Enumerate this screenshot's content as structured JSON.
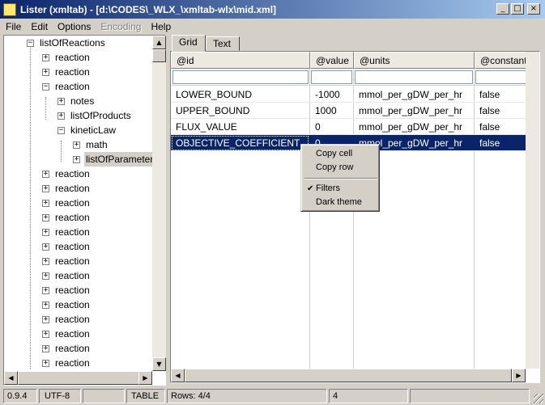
{
  "window": {
    "title": "Lister (xmltab) - [d:\\CODES\\_WLX_\\xmltab-wlx\\mid.xml]",
    "minimize": "_",
    "maximize": "□",
    "close": "×"
  },
  "menu": [
    "File",
    "Edit",
    "Options",
    "Encoding",
    "Help"
  ],
  "tree": {
    "nodes": [
      {
        "label": "listOfReactions",
        "expander": "−"
      },
      {
        "label": "reaction",
        "expander": "+"
      },
      {
        "label": "reaction",
        "expander": "+"
      },
      {
        "label": "reaction",
        "expander": "−"
      },
      {
        "label": "notes",
        "expander": "+"
      },
      {
        "label": "listOfProducts",
        "expander": "+"
      },
      {
        "label": "kineticLaw",
        "expander": "−"
      },
      {
        "label": "math",
        "expander": "+"
      },
      {
        "label": "listOfParameters",
        "expander": "+"
      },
      {
        "label": "reaction",
        "expander": "+"
      },
      {
        "label": "reaction",
        "expander": "+"
      },
      {
        "label": "reaction",
        "expander": "+"
      },
      {
        "label": "reaction",
        "expander": "+"
      },
      {
        "label": "reaction",
        "expander": "+"
      },
      {
        "label": "reaction",
        "expander": "+"
      },
      {
        "label": "reaction",
        "expander": "+"
      },
      {
        "label": "reaction",
        "expander": "+"
      },
      {
        "label": "reaction",
        "expander": "+"
      },
      {
        "label": "reaction",
        "expander": "+"
      },
      {
        "label": "reaction",
        "expander": "+"
      },
      {
        "label": "reaction",
        "expander": "+"
      },
      {
        "label": "reaction",
        "expander": "+"
      },
      {
        "label": "reaction",
        "expander": "+"
      }
    ],
    "selected_index": 8
  },
  "tabs": [
    "Grid",
    "Text"
  ],
  "active_tab": "Grid",
  "grid": {
    "columns": [
      "@id",
      "@value",
      "@units",
      "@constant"
    ],
    "rows": [
      [
        "LOWER_BOUND",
        "-1000",
        "mmol_per_gDW_per_hr",
        "false"
      ],
      [
        "UPPER_BOUND",
        "1000",
        "mmol_per_gDW_per_hr",
        "false"
      ],
      [
        "FLUX_VALUE",
        "0",
        "mmol_per_gDW_per_hr",
        "false"
      ],
      [
        "OBJECTIVE_COEFFICIENT",
        "0",
        "mmol_per_gDW_per_hr",
        "false"
      ]
    ],
    "selected_row": 3
  },
  "context_menu": {
    "items": [
      "Copy cell",
      "Copy row",
      "Filters",
      "Dark theme"
    ],
    "checked": "Filters",
    "check_glyph": "✔"
  },
  "status": {
    "version": "0.9.4",
    "encoding": "UTF-8",
    "mode": "TABLE",
    "rows": "Rows: 4/4",
    "count": "4"
  },
  "scroll": {
    "up": "▲",
    "down": "▼",
    "left": "◀",
    "right": "▶"
  }
}
